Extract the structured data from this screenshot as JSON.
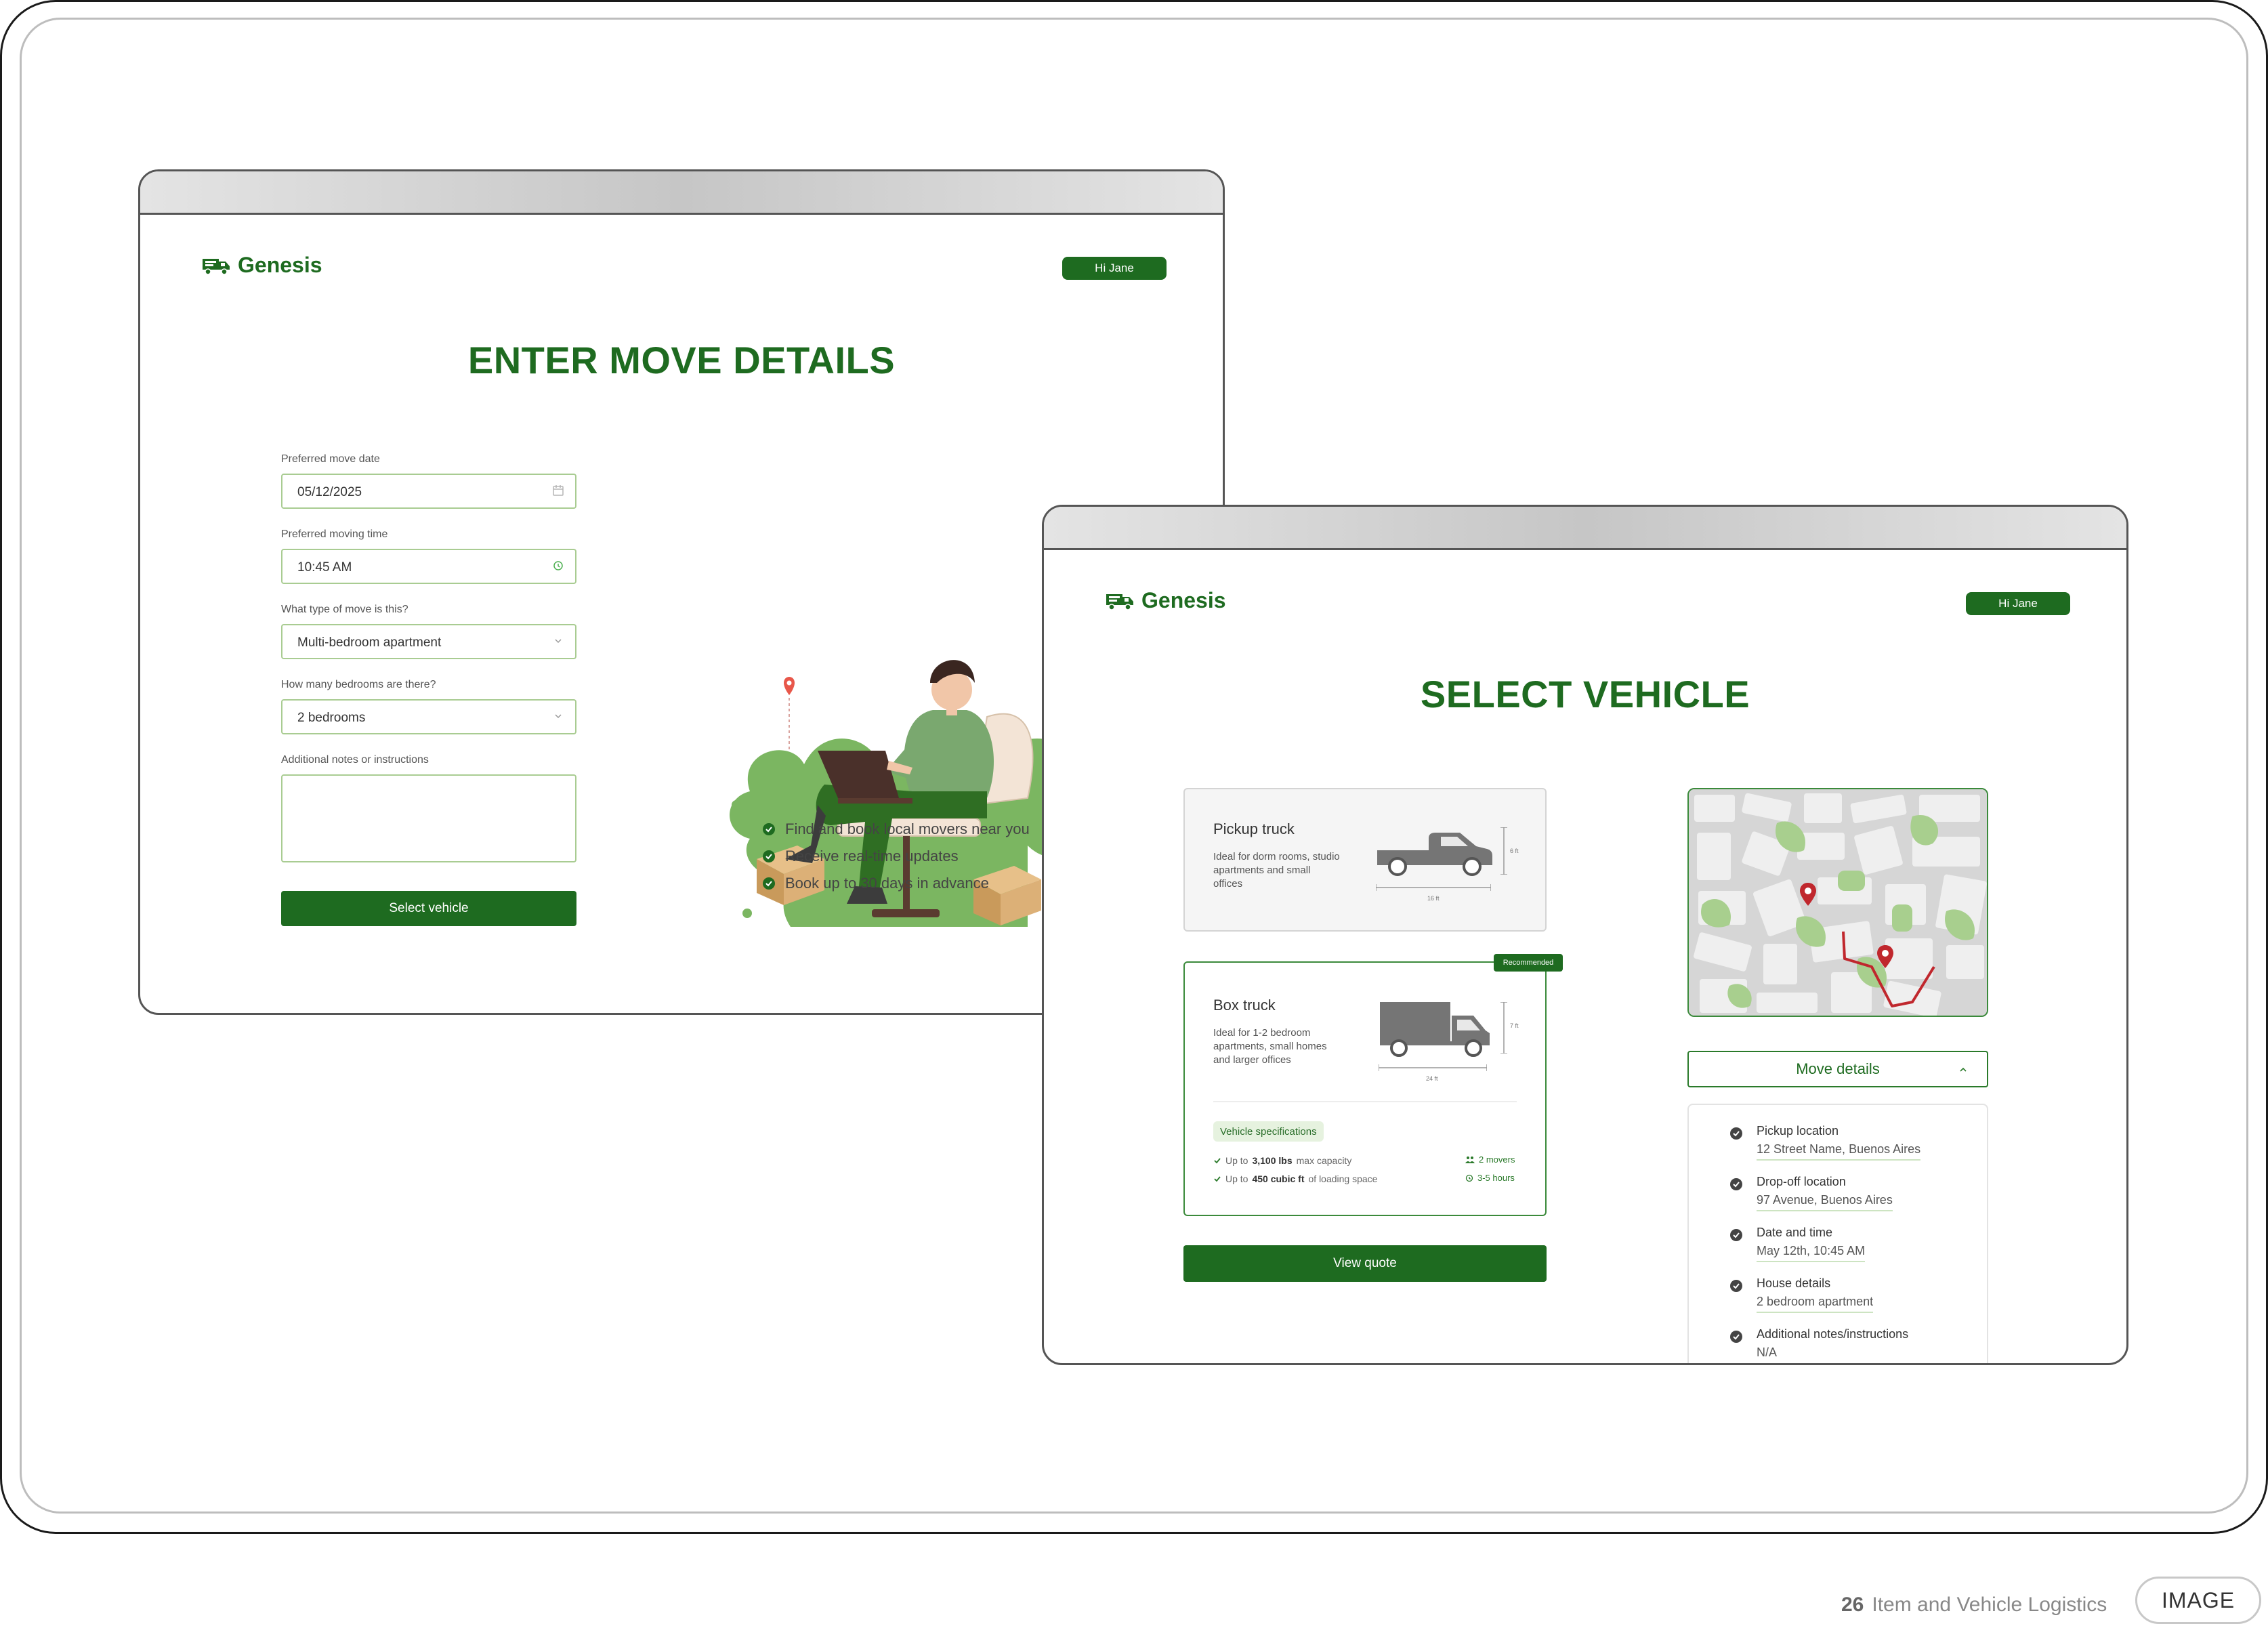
{
  "brand": {
    "name": "Genesis",
    "accent": "#1e6b20"
  },
  "user": {
    "greeting": "Hi Jane"
  },
  "move_details_screen": {
    "title": "ENTER MOVE DETAILS",
    "fields": {
      "date": {
        "label": "Preferred move date",
        "value": "05/12/2025",
        "icon": "calendar-icon"
      },
      "time": {
        "label": "Preferred moving time",
        "value": "10:45 AM",
        "icon": "clock-icon"
      },
      "move_type": {
        "label": "What type of move is this?",
        "value": "Multi-bedroom apartment",
        "icon": "chevron-down-icon"
      },
      "bedrooms": {
        "label": "How many bedrooms are there?",
        "value": "2 bedrooms",
        "icon": "chevron-down-icon"
      },
      "notes": {
        "label": "Additional notes or instructions",
        "value": ""
      }
    },
    "submit_label": "Select vehicle",
    "features": [
      "Find and book local movers near you",
      "Receive real-time updates",
      "Book up to 30 days in advance"
    ]
  },
  "select_vehicle_screen": {
    "title": "SELECT VEHICLE",
    "vehicles": [
      {
        "name": "Pickup truck",
        "description": "Ideal for dorm rooms, studio apartments and small offices",
        "height": "6 ft",
        "length": "16 ft",
        "selected": false
      },
      {
        "name": "Box truck",
        "description": "Ideal for 1-2 bedroom apartments, small homes and larger offices",
        "height": "7 ft",
        "length": "24 ft",
        "badge": "Recommended",
        "selected": true,
        "specs_label": "Vehicle specifications",
        "specs": [
          {
            "pre": "Up to",
            "bold": "3,100 lbs",
            "post": "max capacity"
          },
          {
            "pre": "Up to",
            "bold": "450 cubic ft",
            "post": "of loading space"
          }
        ],
        "crew": "2 movers",
        "duration": "3-5 hours"
      }
    ],
    "quote_label": "View quote",
    "move_details": {
      "title": "Move details",
      "items": [
        {
          "label": "Pickup location",
          "value": "12 Street Name, Buenos Aires"
        },
        {
          "label": "Drop-off location",
          "value": "97 Avenue, Buenos Aires"
        },
        {
          "label": "Date and time",
          "value": "May 12th, 10:45 AM"
        },
        {
          "label": "House details",
          "value": "2 bedroom apartment"
        },
        {
          "label": "Additional notes/instructions",
          "value": "N/A"
        }
      ]
    }
  },
  "footer": {
    "page_number": "26",
    "section": "Item and Vehicle Logistics",
    "tag": "IMAGE"
  }
}
